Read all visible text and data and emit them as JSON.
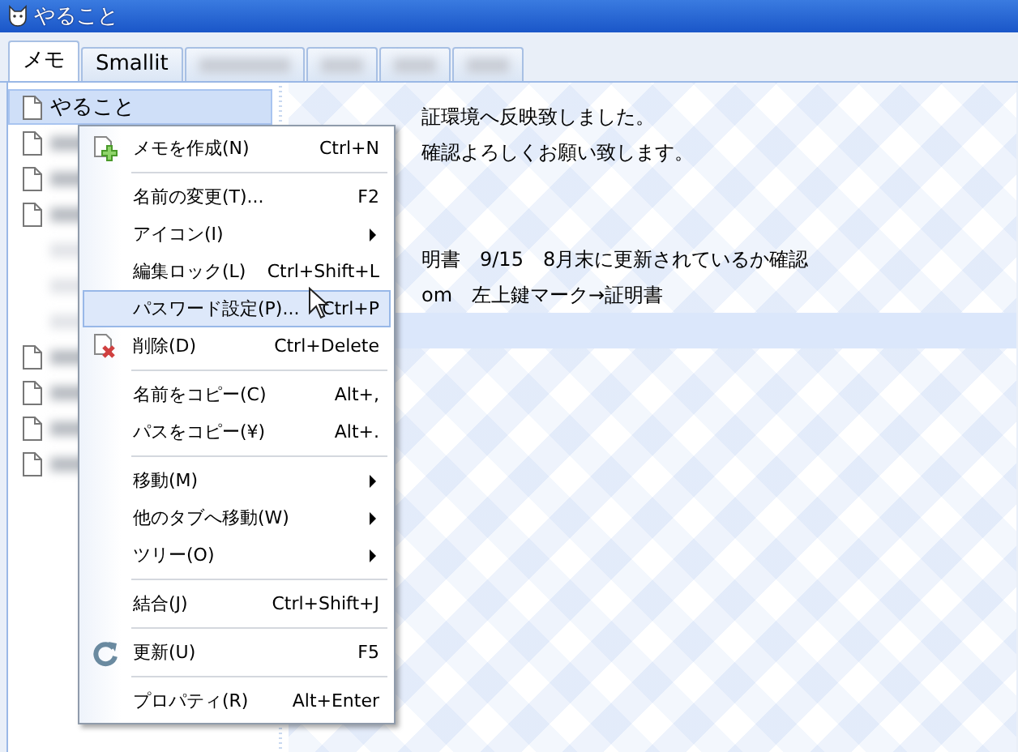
{
  "window": {
    "title": "やること"
  },
  "tabs": [
    {
      "label": "メモ",
      "selected": true
    },
    {
      "label": "Smallit",
      "selected": false
    },
    {
      "kind": "blurred",
      "selected": false
    },
    {
      "kind": "blurred",
      "selected": false
    },
    {
      "kind": "blurred",
      "selected": false
    },
    {
      "kind": "blurred",
      "selected": false
    }
  ],
  "tree": {
    "items": [
      {
        "label": "やること",
        "selected": true,
        "kind": "memo"
      },
      {
        "kind": "blurred",
        "selected": false
      },
      {
        "kind": "blurred",
        "selected": false
      },
      {
        "kind": "blurred",
        "selected": false
      },
      {
        "kind": "blank",
        "selected": false
      },
      {
        "kind": "blank",
        "selected": false
      },
      {
        "kind": "blank",
        "selected": false
      },
      {
        "kind": "blurred",
        "selected": false
      },
      {
        "kind": "blurred",
        "selected": false
      },
      {
        "kind": "blurred",
        "selected": false
      },
      {
        "kind": "blurred",
        "selected": false
      }
    ]
  },
  "editor": {
    "lines": [
      {
        "kind": "text",
        "text": "証環境へ反映致しました。",
        "selected": false
      },
      {
        "kind": "text",
        "text": "確認よろしくお願い致します。",
        "selected": false
      },
      {
        "kind": "blank",
        "selected": false
      },
      {
        "kind": "blank",
        "selected": false
      },
      {
        "kind": "text",
        "text": "明書　9/15　8月末に更新されているか確認",
        "selected": false
      },
      {
        "kind": "text",
        "text": "om　左上鍵マーク→証明書",
        "selected": false
      },
      {
        "kind": "blank",
        "selected": true
      }
    ]
  },
  "context_menu": {
    "items": [
      {
        "kind": "item",
        "label": "メモを作成(N)",
        "shortcut": "Ctrl+N",
        "selected": false
      },
      {
        "kind": "separator"
      },
      {
        "kind": "item",
        "label": "名前の変更(T)...",
        "shortcut": "F2",
        "selected": false
      },
      {
        "kind": "submenu",
        "label": "アイコン(I)",
        "selected": false
      },
      {
        "kind": "item",
        "label": "編集ロック(L)",
        "shortcut": "Ctrl+Shift+L",
        "selected": false
      },
      {
        "kind": "item",
        "label": "パスワード設定(P)...",
        "shortcut": "Ctrl+P",
        "selected": true
      },
      {
        "kind": "item",
        "label": "削除(D)",
        "shortcut": "Ctrl+Delete",
        "selected": false
      },
      {
        "kind": "separator"
      },
      {
        "kind": "item",
        "label": "名前をコピー(C)",
        "shortcut": "Alt+,",
        "selected": false
      },
      {
        "kind": "item",
        "label": "パスをコピー(¥)",
        "shortcut": "Alt+.",
        "selected": false
      },
      {
        "kind": "separator"
      },
      {
        "kind": "submenu",
        "label": "移動(M)",
        "selected": false
      },
      {
        "kind": "submenu",
        "label": "他のタブへ移動(W)",
        "selected": false
      },
      {
        "kind": "submenu",
        "label": "ツリー(O)",
        "selected": false
      },
      {
        "kind": "separator"
      },
      {
        "kind": "item",
        "label": "結合(J)",
        "shortcut": "Ctrl+Shift+J",
        "selected": false
      },
      {
        "kind": "separator"
      },
      {
        "kind": "item",
        "label": "更新(U)",
        "shortcut": "F5",
        "selected": false
      },
      {
        "kind": "separator"
      },
      {
        "kind": "item",
        "label": "プロパティ(R)",
        "shortcut": "Alt+Enter",
        "selected": false
      }
    ]
  }
}
